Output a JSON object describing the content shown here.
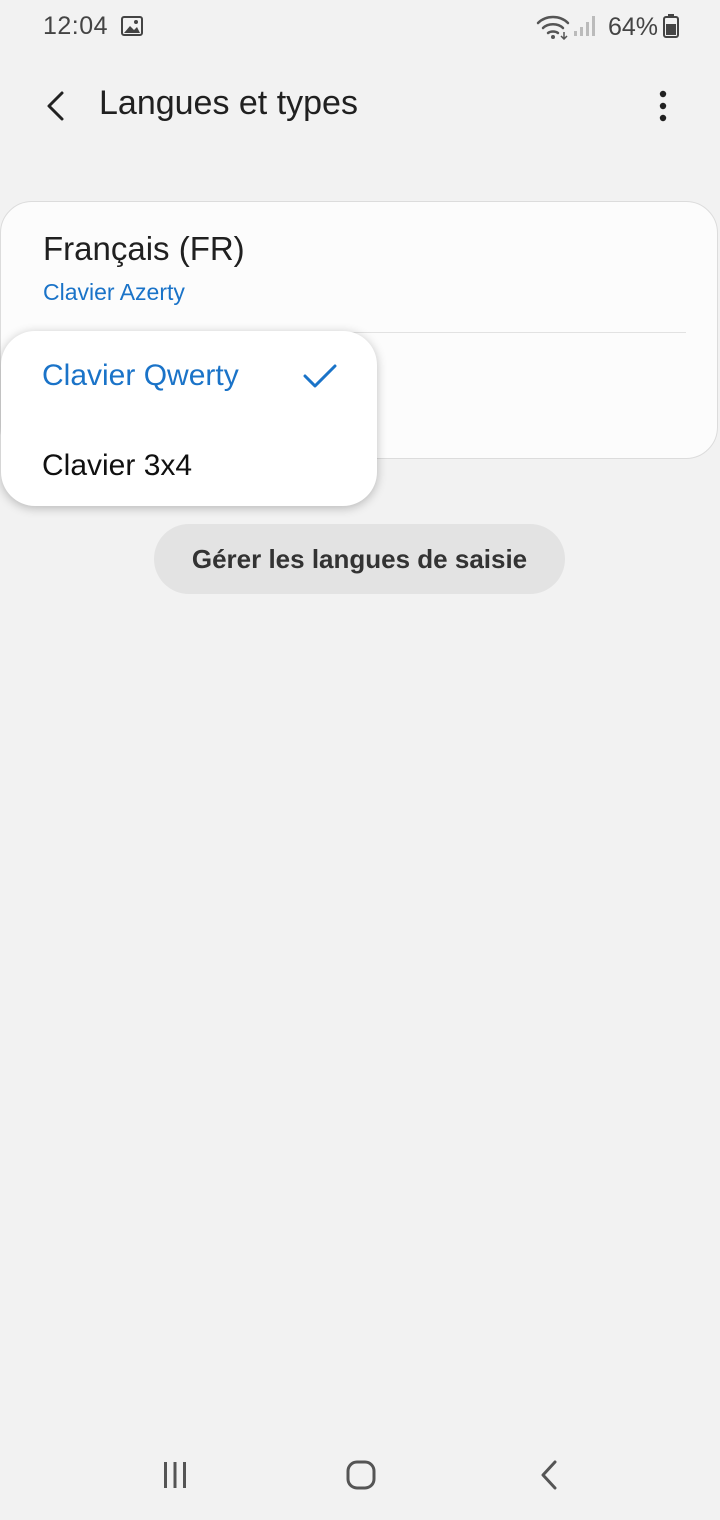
{
  "status_bar": {
    "time": "12:04",
    "battery_percent": "64%",
    "icons": [
      "gallery-icon",
      "wifi-icon",
      "signal-icon",
      "battery-icon"
    ]
  },
  "app_bar": {
    "title": "Langues et types",
    "back_icon": "chevron-left-icon",
    "menu_icon": "more-vertical-icon"
  },
  "language_card": {
    "language_title": "Français (FR)",
    "language_subtitle": "Clavier Azerty"
  },
  "keyboard_popup": {
    "options": [
      {
        "label": "Clavier Qwerty",
        "selected": true
      },
      {
        "label": "Clavier 3x4",
        "selected": false
      }
    ]
  },
  "manage_button": {
    "label": "Gérer les langues de saisie"
  },
  "navigation": {
    "icons": [
      "recent-apps-icon",
      "home-icon",
      "back-icon"
    ]
  },
  "colors": {
    "background": "#f2f2f2",
    "accent": "#1a73c8",
    "text": "#202020",
    "card": "#fcfcfc",
    "button": "#e3e3e3"
  }
}
